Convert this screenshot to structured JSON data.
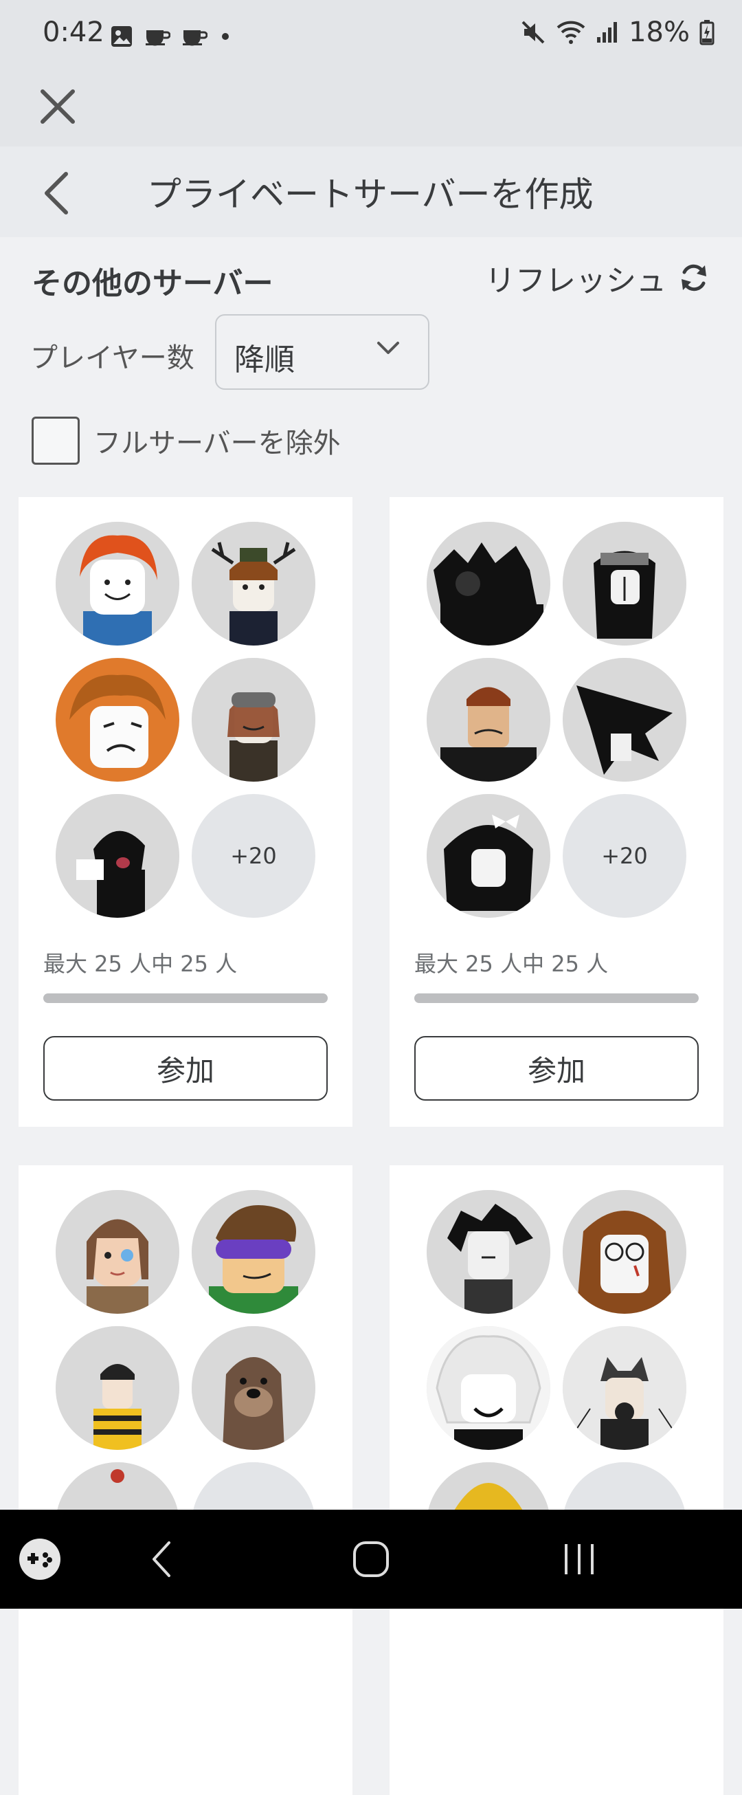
{
  "status_bar": {
    "time": "0:42",
    "battery": "18%"
  },
  "header": {
    "title": "プライベートサーバーを作成"
  },
  "section": {
    "title": "その他のサーバー",
    "refresh_label": "リフレッシュ"
  },
  "filters": {
    "sort_label": "プレイヤー数",
    "sort_value": "降順",
    "exclude_full_label": "フルサーバーを除外"
  },
  "servers": [
    {
      "more_players": "+20",
      "capacity_text": "最大 25 人中 25 人",
      "fill_fraction": 1.0,
      "join_label": "参加"
    },
    {
      "more_players": "+20",
      "capacity_text": "最大 25 人中 25 人",
      "fill_fraction": 1.0,
      "join_label": "参加"
    },
    {},
    {}
  ],
  "colors": {
    "background": "#f0f1f3",
    "card": "#ffffff",
    "text": "#393b3d",
    "navbar": "#000000"
  }
}
